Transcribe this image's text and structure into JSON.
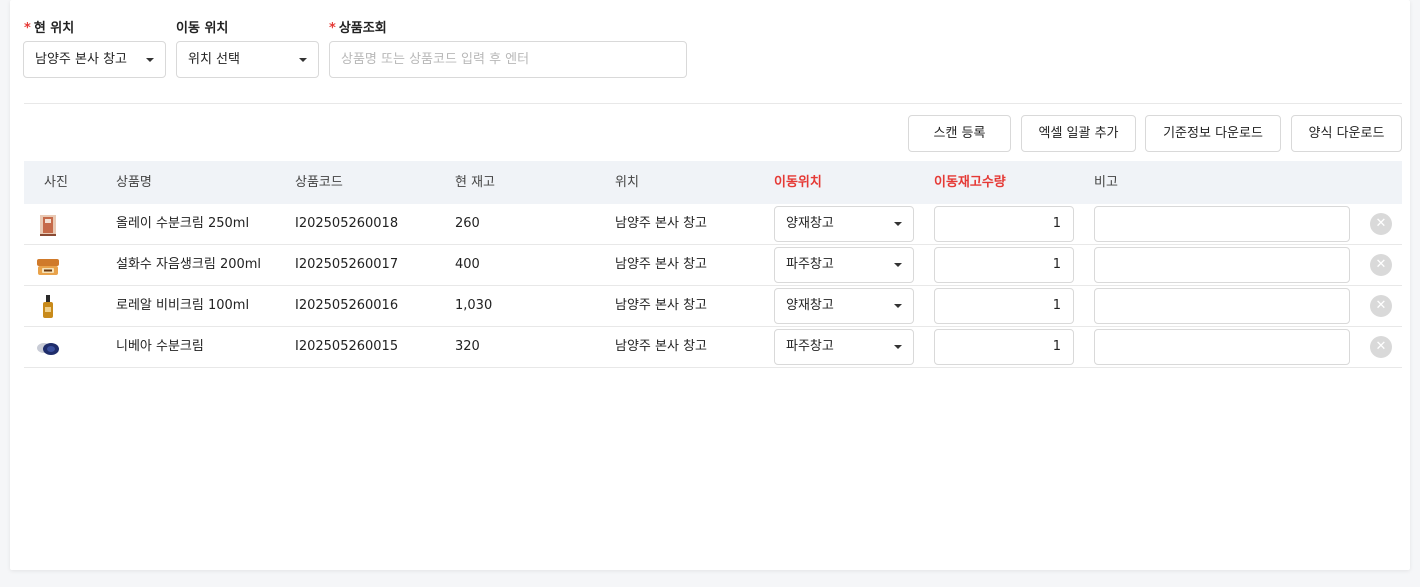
{
  "filters": {
    "current_location": {
      "label": "현 위치",
      "required": true,
      "value": "남양주 본사 창고"
    },
    "move_location": {
      "label": "이동 위치",
      "required": false,
      "value": "위치 선택"
    },
    "product_search": {
      "label": "상품조회",
      "required": true,
      "placeholder": "상품명 또는 상품코드 입력 후 엔터",
      "value": ""
    }
  },
  "actions": {
    "scan": "스캔 등록",
    "excel_bulk": "엑셀 일괄 추가",
    "base_info_download": "기준정보 다운로드",
    "template_download": "양식 다운로드"
  },
  "table": {
    "columns": [
      "사진",
      "상품명",
      "상품코드",
      "현 재고",
      "위치",
      "이동위치",
      "이동재고수량",
      "비고"
    ],
    "highlight_columns": [
      "이동위치",
      "이동재고수량"
    ],
    "rows": [
      {
        "image": "cream-box-icon",
        "name": "올레이 수분크림 250ml",
        "code": "I202505260018",
        "stock": "260",
        "location": "남양주 본사 창고",
        "move_to": "양재창고",
        "qty": "1",
        "memo": ""
      },
      {
        "image": "cream-jar-icon",
        "name": "설화수 자음생크림 200ml",
        "code": "I202505260017",
        "stock": "400",
        "location": "남양주 본사 창고",
        "move_to": "파주창고",
        "qty": "1",
        "memo": ""
      },
      {
        "image": "serum-bottle-icon",
        "name": "로레알 비비크림 100ml",
        "code": "I202505260016",
        "stock": "1,030",
        "location": "남양주 본사 창고",
        "move_to": "양재창고",
        "qty": "1",
        "memo": ""
      },
      {
        "image": "tin-can-icon",
        "name": "니베아 수분크림",
        "code": "I202505260015",
        "stock": "320",
        "location": "남양주 본사 창고",
        "move_to": "파주창고",
        "qty": "1",
        "memo": ""
      }
    ]
  },
  "colors": {
    "required": "#e53935",
    "header_bg": "#f0f3f7",
    "border": "#d9d9d9",
    "delete_icon": "#d9d9d9"
  }
}
